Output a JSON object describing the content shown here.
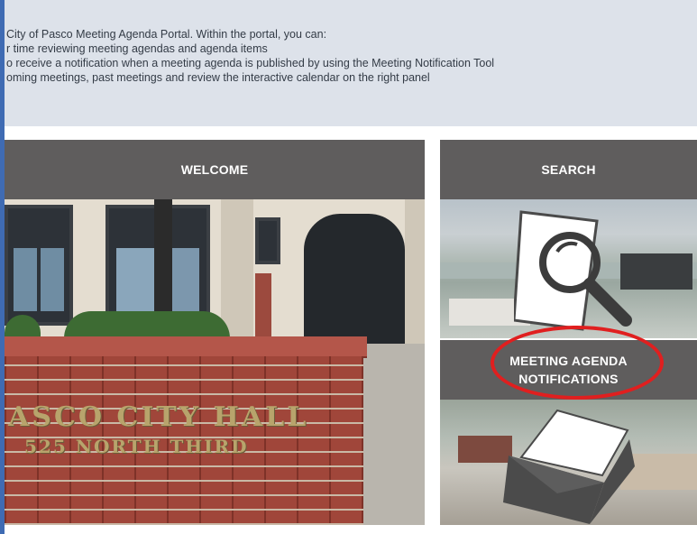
{
  "intro": {
    "lines": [
      "City of Pasco Meeting Agenda Portal. Within the portal, you can:",
      "r time reviewing meeting agendas and agenda items",
      "o receive a notification when a meeting agenda is published by using the Meeting Notification Tool",
      "oming meetings, past meetings and review the interactive calendar on the right panel"
    ]
  },
  "panels": {
    "welcome": {
      "title": "WELCOME",
      "sign_line1": "ASCO CITY HALL",
      "sign_line2": "525 NORTH THIRD"
    },
    "search": {
      "title": "SEARCH"
    },
    "notifications": {
      "title_line1": "MEETING AGENDA",
      "title_line2": "NOTIFICATIONS"
    }
  },
  "icons": {
    "search": "magnifier-on-document-icon",
    "notifications": "envelope-icon"
  },
  "colors": {
    "header_bg": "#5f5d5d",
    "intro_bg": "#dde2ea",
    "annotation": "#e01f1f",
    "frame": "#3f6bb3"
  }
}
